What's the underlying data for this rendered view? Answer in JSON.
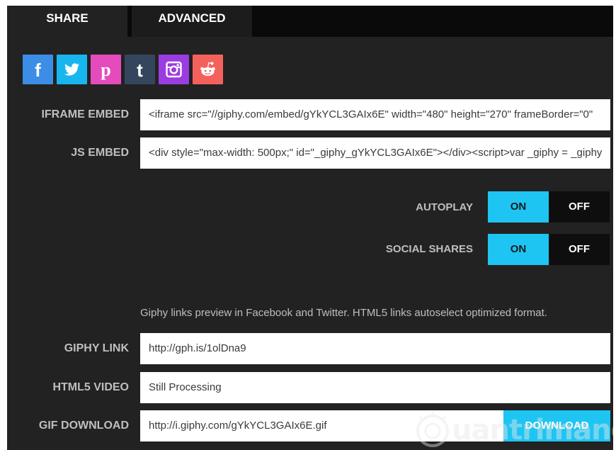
{
  "tabs": {
    "share": "SHARE",
    "advanced": "ADVANCED"
  },
  "social": [
    {
      "name": "facebook",
      "glyph": "f",
      "color": "#3b8de6"
    },
    {
      "name": "twitter",
      "color": "#18b6ee"
    },
    {
      "name": "pinterest",
      "glyph": "p",
      "color": "#e44bbd"
    },
    {
      "name": "tumblr",
      "glyph": "t",
      "color": "#34465d"
    },
    {
      "name": "instagram",
      "color": "#9b3ce2"
    },
    {
      "name": "reddit",
      "color": "#f4615d"
    }
  ],
  "embed": {
    "iframe_label": "IFRAME EMBED",
    "iframe_value": "<iframe src=\"//giphy.com/embed/gYkYCL3GAIx6E\" width=\"480\" height=\"270\" frameBorder=\"0\"",
    "js_label": "JS EMBED",
    "js_value": "<div style=\"max-width: 500px;\" id=\"_giphy_gYkYCL3GAIx6E\"></div><script>var _giphy = _giphy"
  },
  "options": {
    "autoplay_label": "AUTOPLAY",
    "social_label": "SOCIAL SHARES",
    "on": "ON",
    "off": "OFF"
  },
  "note": "Giphy links preview in Facebook and Twitter. HTML5 links autoselect optimized format.",
  "links": {
    "giphy_label": "GIPHY LINK",
    "giphy_value": "http://gph.is/1olDna9",
    "html5_label": "HTML5 VIDEO",
    "html5_value": "Still Processing",
    "gif_label": "GIF DOWNLOAD",
    "gif_value": "http://i.giphy.com/gYkYCL3GAIx6E.gif",
    "download_button": "DOWNLOAD"
  },
  "watermark": "uantrimang",
  "colors": {
    "accent": "#1ec5f2",
    "panel": "#222222",
    "tabbar": "#0a0a0a"
  }
}
